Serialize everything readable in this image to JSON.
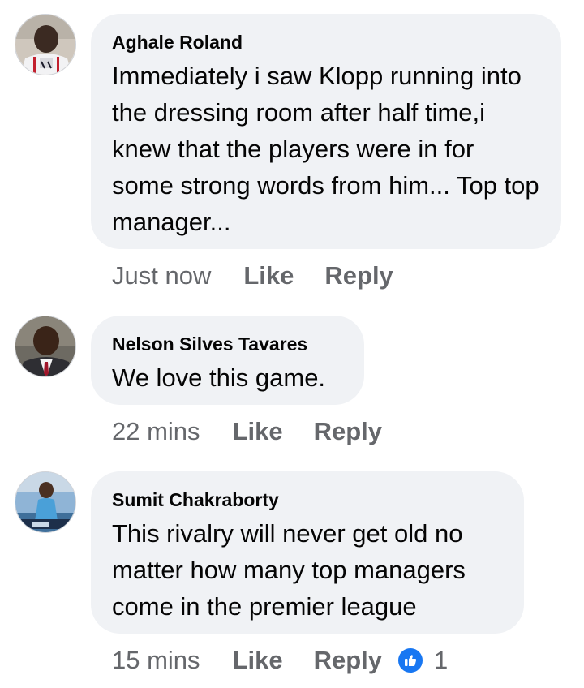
{
  "comments": [
    {
      "author": "Aghale Roland",
      "text": "Immediately i saw Klopp running into the dressing room after half time,i knew that the players were in for some strong words from him... Top top manager...",
      "time": "Just now",
      "like_label": "Like",
      "reply_label": "Reply"
    },
    {
      "author": "Nelson Silves Tavares",
      "text": "We love this game.",
      "time": "22 mins",
      "like_label": "Like",
      "reply_label": "Reply"
    },
    {
      "author": "Sumit Chakraborty",
      "text": "This rivalry will never get old no matter how many top managers come in the premier league",
      "time": "15 mins",
      "like_label": "Like",
      "reply_label": "Reply",
      "reaction_icon": "thumbs-up-icon",
      "reaction_count": "1"
    }
  ],
  "colors": {
    "bubble": "#f0f2f5",
    "secondary_text": "#65676b",
    "like_reaction": "#1877f2"
  }
}
